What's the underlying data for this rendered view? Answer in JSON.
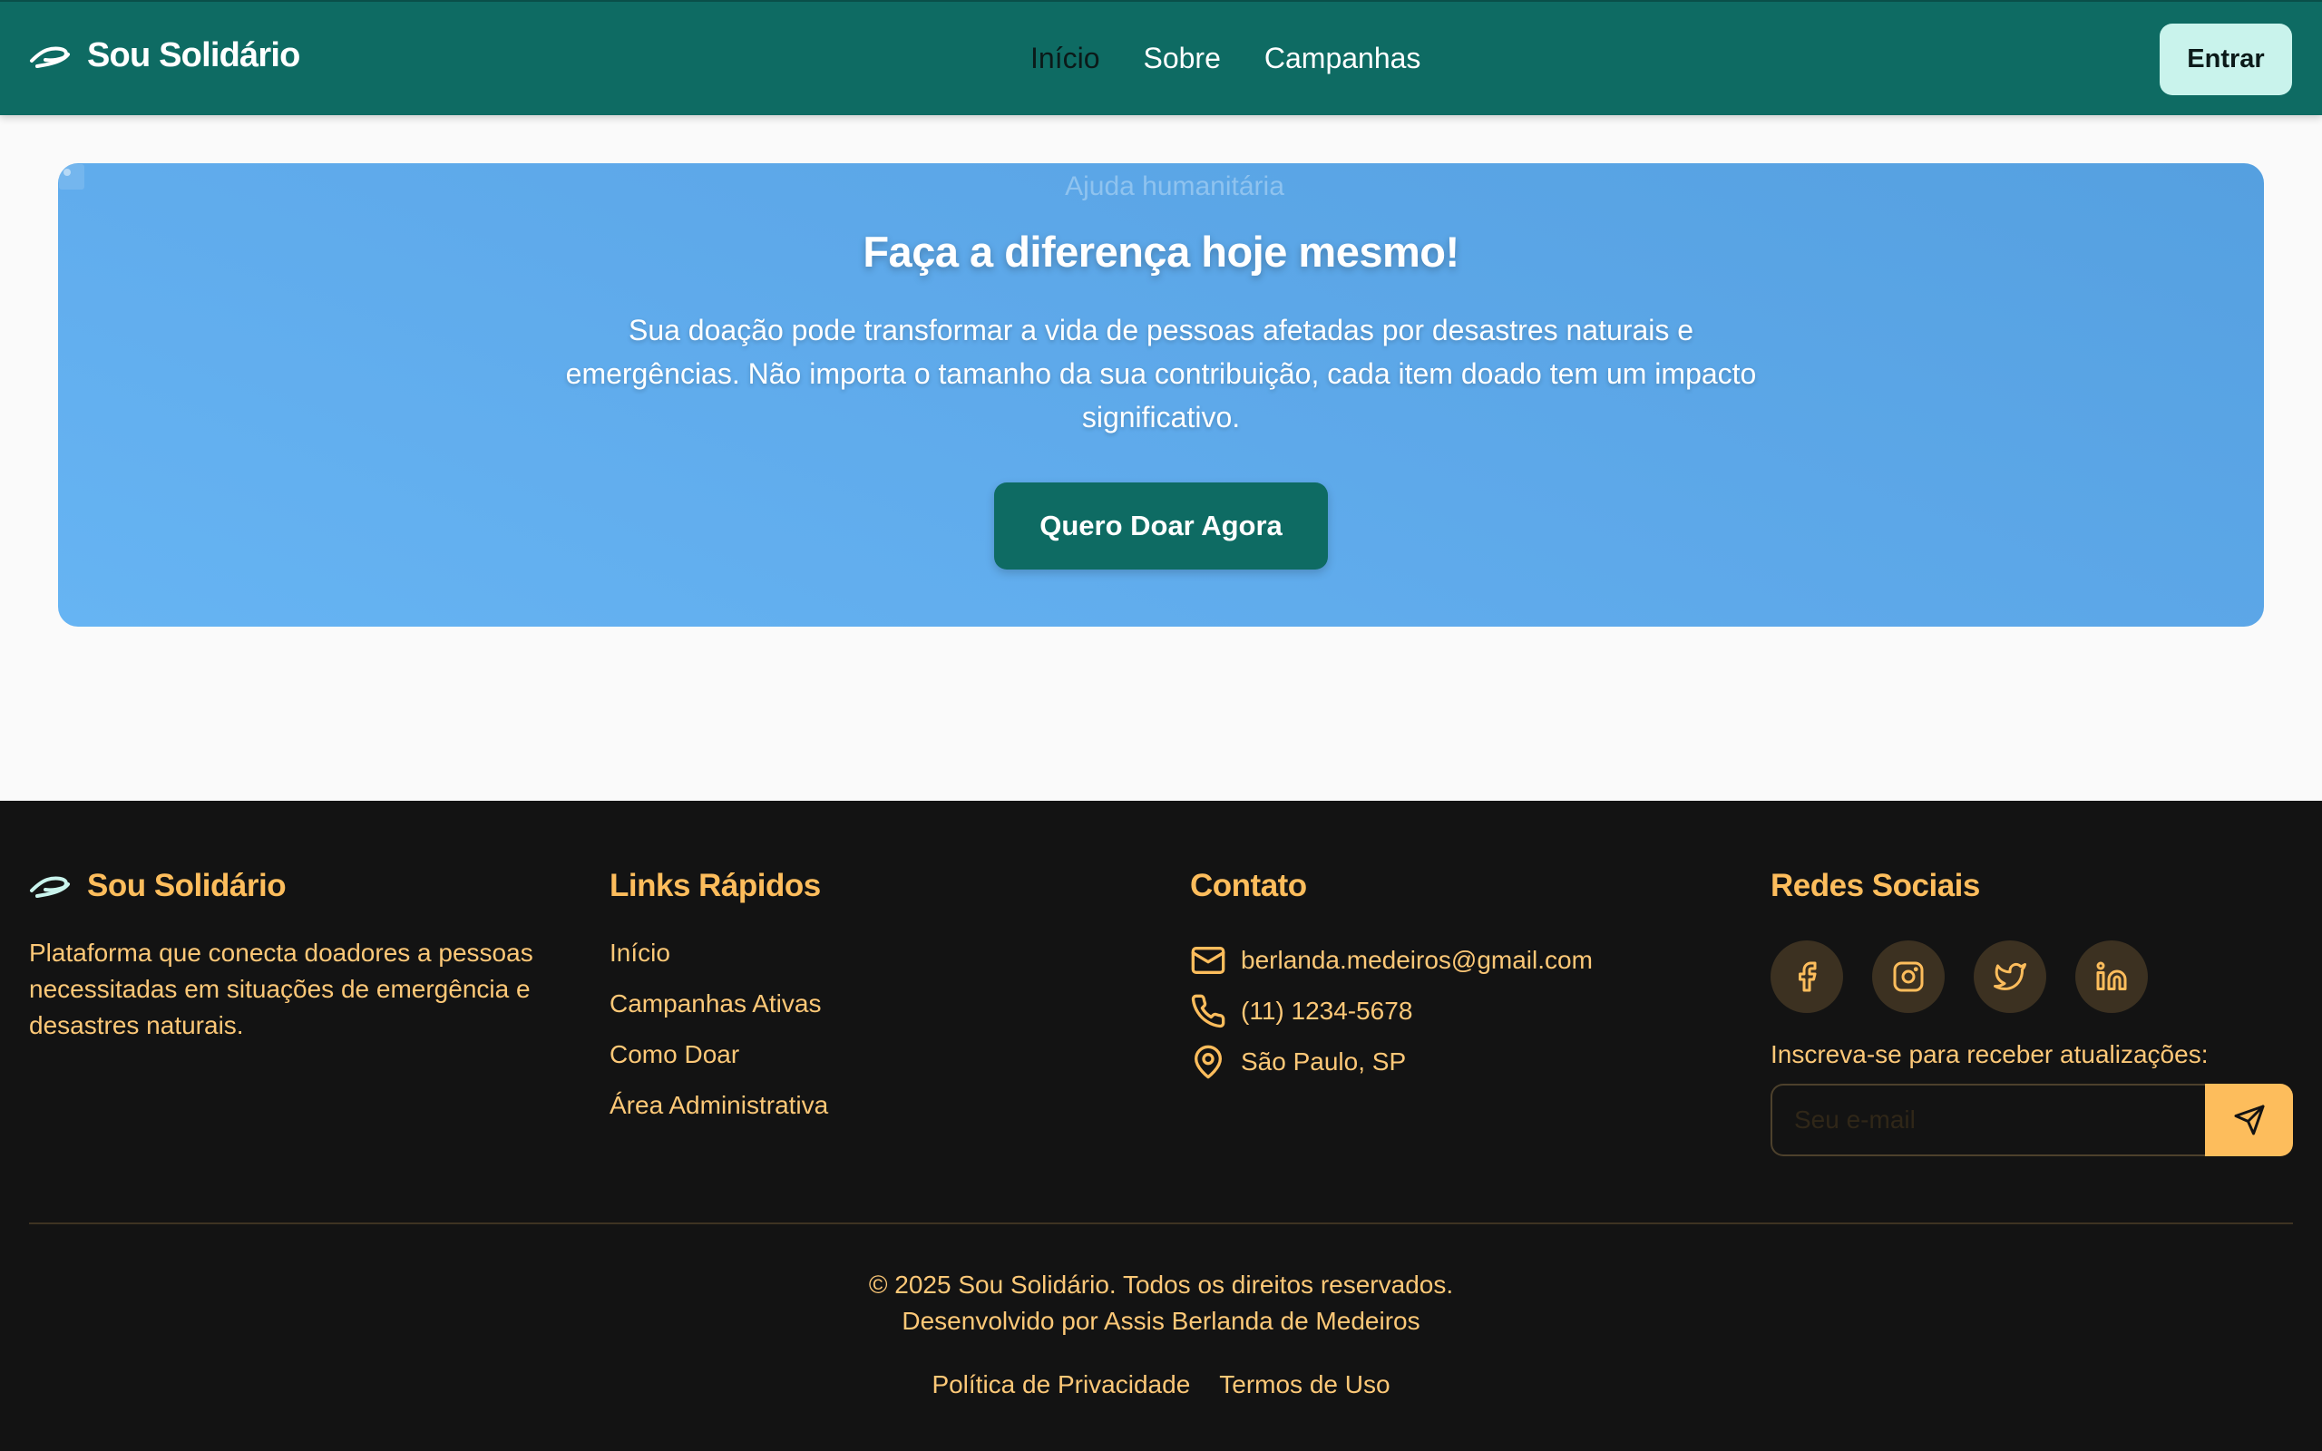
{
  "header": {
    "brand": "Sou Solidário",
    "nav": [
      "Início",
      "Sobre",
      "Campanhas"
    ],
    "login": "Entrar"
  },
  "hero": {
    "image_alt": "Ajuda humanitária",
    "title": "Faça a diferença hoje mesmo!",
    "text": "Sua doação pode transformar a vida de pessoas afetadas por desastres naturais e emergências. Não importa o tamanho da sua contribuição, cada item doado tem um impacto significativo.",
    "cta": "Quero Doar Agora"
  },
  "footer": {
    "brand": "Sou Solidário",
    "description": "Plataforma que conecta doadores a pessoas necessitadas em situações de emergência e desastres naturais.",
    "links_title": "Links Rápidos",
    "links": [
      "Início",
      "Campanhas Ativas",
      "Como Doar",
      "Área Administrativa"
    ],
    "contact_title": "Contato",
    "email": "berlanda.medeiros@gmail.com",
    "phone": "(11) 1234-5678",
    "location": "São Paulo, SP",
    "social_title": "Redes Sociais",
    "social_icons": [
      "facebook-icon",
      "instagram-icon",
      "twitter-icon",
      "linkedin-icon"
    ],
    "subscribe_label": "Inscreva-se para receber atualizações:",
    "subscribe_placeholder": "Seu e-mail",
    "copyright": "© 2025 Sou Solidário. Todos os direitos reservados.",
    "developer": "Desenvolvido por Assis Berlanda de Medeiros",
    "privacy": "Política de Privacidade",
    "terms": "Termos de Uso"
  },
  "colors": {
    "header_bg": "#0e6b63",
    "accent": "#fdbd5c",
    "hero_blue": "#5ea9ea",
    "footer_bg": "#131313",
    "login_bg": "#c9f3ec"
  }
}
